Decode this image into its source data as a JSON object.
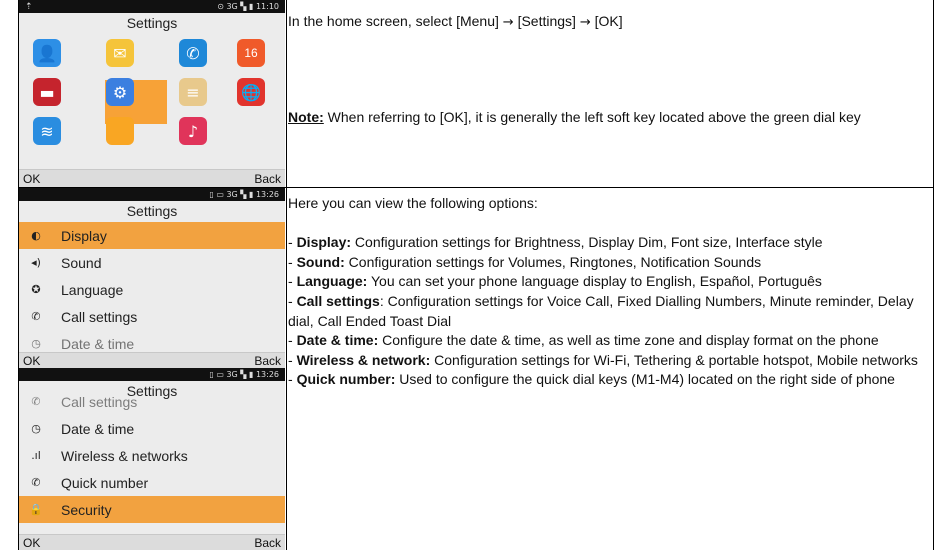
{
  "row1": {
    "phone": {
      "status_text": "⊙ 3G ▚ ▮ 11:10",
      "title": "Settings",
      "apps": [
        {
          "icon": "contacts-icon",
          "glyph": "👤",
          "color": "#2d8fe6"
        },
        {
          "icon": "messages-icon",
          "glyph": "✉",
          "color": "#f5c43a"
        },
        {
          "icon": "phone-icon",
          "glyph": "✆",
          "color": "#1e88d8"
        },
        {
          "icon": "calendar-icon",
          "glyph": "16",
          "color": "#f05a2a"
        },
        {
          "icon": "toolbox-icon",
          "glyph": "▬",
          "color": "#c5242d"
        },
        {
          "icon": "settings-gear-icon",
          "glyph": "⚙",
          "color": "#3b7fe0"
        },
        {
          "icon": "notes-icon",
          "glyph": "≡",
          "color": "#e8c98c"
        },
        {
          "icon": "browser-globe-icon",
          "glyph": "🌐",
          "color": "#e1342d"
        },
        {
          "icon": "wifi-icon",
          "glyph": "≋",
          "color": "#2a8de0"
        },
        {
          "icon": "file-manager-icon",
          "glyph": "",
          "color": "#f9a623"
        },
        {
          "icon": "music-icon",
          "glyph": "♪",
          "color": "#e0345a"
        }
      ],
      "soft_left": "OK",
      "soft_right": "Back"
    },
    "text": {
      "line1_pre": "In the home screen, select [Menu] ",
      "arrow": "→",
      "line1_mid": " [Settings] ",
      "line1_post": " [OK]",
      "note_label": "Note:",
      "note_text": " When referring to [OK], it is generally the left soft key located above the green dial key"
    }
  },
  "row2": {
    "phone_a": {
      "status_text": "▯ ▭ 3G ▚ ▮ 13:26",
      "title": "Settings",
      "items": [
        {
          "icon": "display-icon",
          "glyph": "◐",
          "label": "Display",
          "selected": true
        },
        {
          "icon": "sound-icon",
          "glyph": "◂)",
          "label": "Sound",
          "selected": false
        },
        {
          "icon": "language-icon",
          "glyph": "✪",
          "label": "Language",
          "selected": false
        },
        {
          "icon": "call-icon",
          "glyph": "✆",
          "label": "Call settings",
          "selected": false
        },
        {
          "icon": "clock-icon",
          "glyph": "◷",
          "label": "Date & time",
          "selected": false
        }
      ],
      "soft_left": "OK",
      "soft_right": "Back"
    },
    "phone_b": {
      "status_text": "▯ ▭ 3G ▚ ▮ 13:26",
      "title": "Settings",
      "items": [
        {
          "icon": "call-icon",
          "glyph": "✆",
          "label": "Call settings",
          "selected": false
        },
        {
          "icon": "clock-icon",
          "glyph": "◷",
          "label": "Date & time",
          "selected": false
        },
        {
          "icon": "signal-icon",
          "glyph": ".ıl",
          "label": "Wireless & networks",
          "selected": false
        },
        {
          "icon": "quick-number-icon",
          "glyph": "✆",
          "label": "Quick number",
          "selected": false
        },
        {
          "icon": "lock-icon",
          "glyph": "🔒",
          "label": "Security",
          "selected": true
        }
      ],
      "soft_left": "OK",
      "soft_right": "Back"
    },
    "text": {
      "intro": "Here you can view the following options:",
      "options": [
        {
          "term": "Display:",
          "desc": " Configuration settings for Brightness, Display Dim, Font size, Interface style"
        },
        {
          "term": "Sound:",
          "desc": " Configuration settings for Volumes, Ringtones, Notification Sounds"
        },
        {
          "term": "Language:",
          "desc": " You can set your phone language display to English, Español, Português"
        },
        {
          "term": "Call settings",
          "desc": ": Configuration settings for Voice Call, Fixed Dialling Numbers, Minute reminder, Delay dial, Call Ended Toast Dial"
        },
        {
          "term": "Date & time:",
          "desc": " Configure the date & time, as well as time zone and display format on the phone"
        },
        {
          "term": "Wireless & network:",
          "desc": " Configuration settings for Wi-Fi, Tethering & portable hotspot, Mobile networks"
        },
        {
          "term": "Quick number:",
          "desc": " Used to configure the quick dial keys (M1-M4) located on the right side of phone"
        }
      ]
    }
  }
}
